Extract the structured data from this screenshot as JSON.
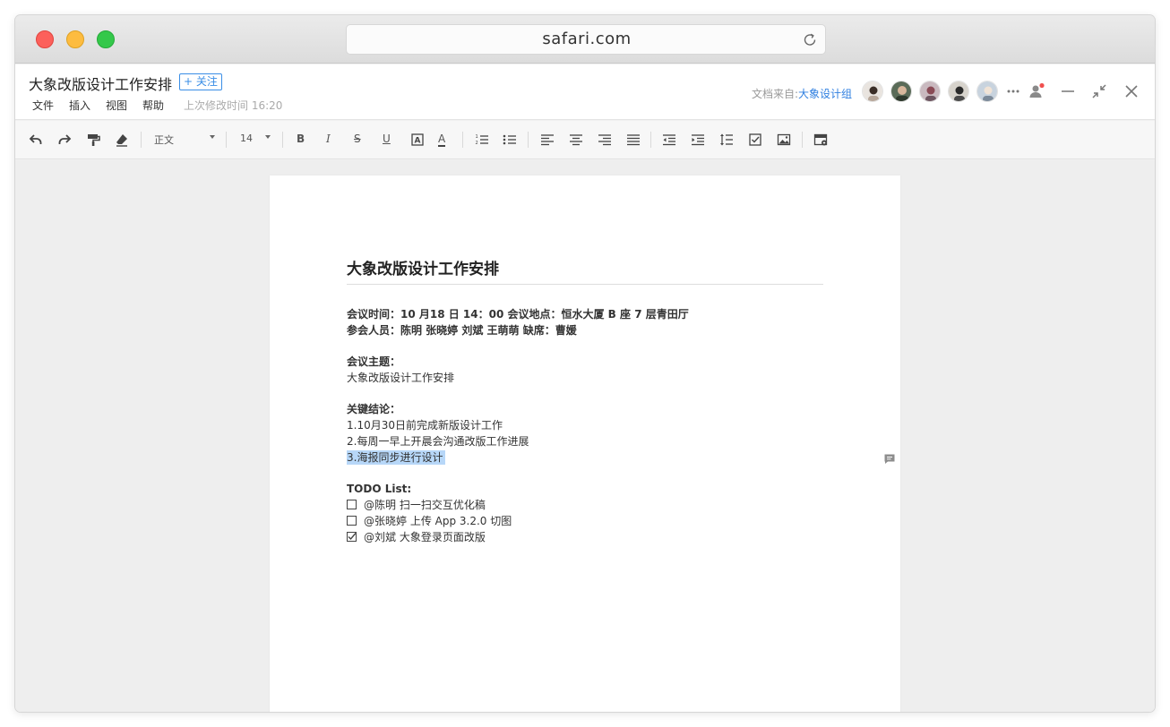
{
  "browser": {
    "url": "safari.com"
  },
  "header": {
    "title": "大象改版设计工作安排",
    "follow_label": "+ 关注",
    "menu": [
      "文件",
      "插入",
      "视图",
      "帮助"
    ],
    "last_edit": "上次修改时间 16:20",
    "source_prefix": "文档来自:",
    "source_group": "大象设计组"
  },
  "toolbar": {
    "paragraph_style": "正文",
    "font_size": "14",
    "bold": "B",
    "italic": "I",
    "strike": "S",
    "underline": "U",
    "font_color": "A"
  },
  "document": {
    "heading": "大象改版设计工作安排",
    "meeting_time": "会议时间：10 月18 日 14：00    会议地点：恒水大厦 B 座 7 层青田厅",
    "attendees": "参会人员：陈明 张晓婷 刘斌 王萌萌        缺席：曹媛",
    "topic_label": "会议主题：",
    "topic": "大象改版设计工作安排",
    "conclusion_label": "关键结论：",
    "conclusions": [
      "1.10月30日前完成新版设计工作",
      "2.每周一早上开晨会沟通改版工作进展",
      "3.海报同步进行设计"
    ],
    "todo_label": "TODO List:",
    "todos": [
      {
        "text": "@陈明 扫一扫交互优化稿",
        "done": false
      },
      {
        "text": "@张晓婷 上传 App 3.2.0 切图",
        "done": false
      },
      {
        "text": "@刘斌 大象登录页面改版",
        "done": true
      }
    ]
  },
  "colors": {
    "accent": "#3a8ee6",
    "highlight": "#b7d7f8",
    "notification": "#f0504f"
  }
}
